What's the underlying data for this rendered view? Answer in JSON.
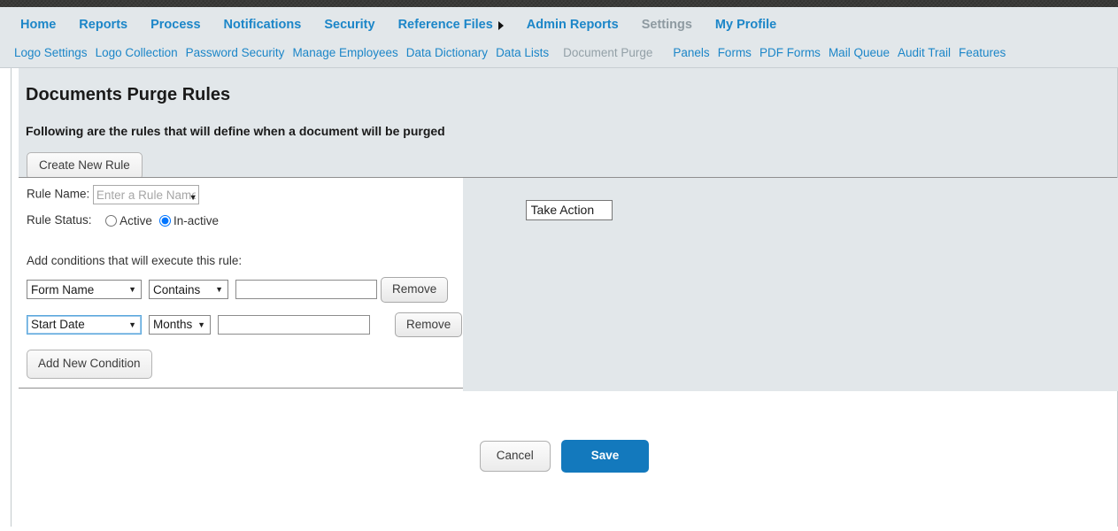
{
  "primary_nav": {
    "items": [
      {
        "label": "Home",
        "state": "normal",
        "caret": false
      },
      {
        "label": "Reports",
        "state": "normal",
        "caret": false
      },
      {
        "label": "Process",
        "state": "normal",
        "caret": false
      },
      {
        "label": "Notifications",
        "state": "normal",
        "caret": false
      },
      {
        "label": "Security",
        "state": "normal",
        "caret": false
      },
      {
        "label": "Reference Files",
        "state": "normal",
        "caret": true
      },
      {
        "label": "Admin Reports",
        "state": "normal",
        "caret": false
      },
      {
        "label": "Settings",
        "state": "disabled",
        "caret": false
      },
      {
        "label": "My Profile",
        "state": "normal",
        "caret": false
      }
    ]
  },
  "secondary_nav": {
    "items": [
      {
        "label": "Logo Settings",
        "state": "normal"
      },
      {
        "label": "Logo Collection",
        "state": "normal"
      },
      {
        "label": "Password Security",
        "state": "normal"
      },
      {
        "label": "Manage Employees",
        "state": "normal"
      },
      {
        "label": "Data Dictionary",
        "state": "normal"
      },
      {
        "label": "Data Lists",
        "state": "normal"
      },
      {
        "label": "Document Purge",
        "state": "disabled"
      },
      {
        "label": "Panels",
        "state": "normal"
      },
      {
        "label": "Forms",
        "state": "normal"
      },
      {
        "label": "PDF Forms",
        "state": "normal"
      },
      {
        "label": "Mail Queue",
        "state": "normal"
      },
      {
        "label": "Audit Trail",
        "state": "normal"
      },
      {
        "label": "Features",
        "state": "normal"
      }
    ]
  },
  "page": {
    "title": "Documents Purge Rules",
    "subtitle": "Following are the rules that will define when a document will be purged",
    "create_new_rule_label": "Create New Rule"
  },
  "rule_form": {
    "rule_name_label": "Rule Name:",
    "rule_name_value": "",
    "rule_name_placeholder": "Enter a Rule Name",
    "take_action_selected": "Take Action",
    "take_action_options": [
      "Take Action"
    ],
    "status_label": "Rule Status:",
    "status_options": [
      {
        "label": "Active",
        "selected": false
      },
      {
        "label": "In-active",
        "selected": true
      }
    ],
    "conditions_intro": "Add conditions that will execute this rule:",
    "conditions": [
      {
        "field_selected": "Form Name",
        "field_options": [
          "Form Name"
        ],
        "operator_selected": "Contains",
        "operator_options": [
          "Contains"
        ],
        "value": "",
        "remove_label": "Remove",
        "focused": false
      },
      {
        "field_selected": "Start Date",
        "field_options": [
          "Start Date"
        ],
        "operator_selected": "Months",
        "operator_options": [
          "Months"
        ],
        "value": "",
        "remove_label": "Remove",
        "focused": true
      }
    ],
    "add_condition_label": "Add New Condition"
  },
  "footer": {
    "cancel_label": "Cancel",
    "save_label": "Save"
  },
  "colors": {
    "link_blue": "#1c86c8",
    "disabled_gray": "#8e9aa1",
    "panel_gray": "#e2e7ea",
    "save_blue": "#1379bd",
    "top_strip": "#3a3a38"
  }
}
